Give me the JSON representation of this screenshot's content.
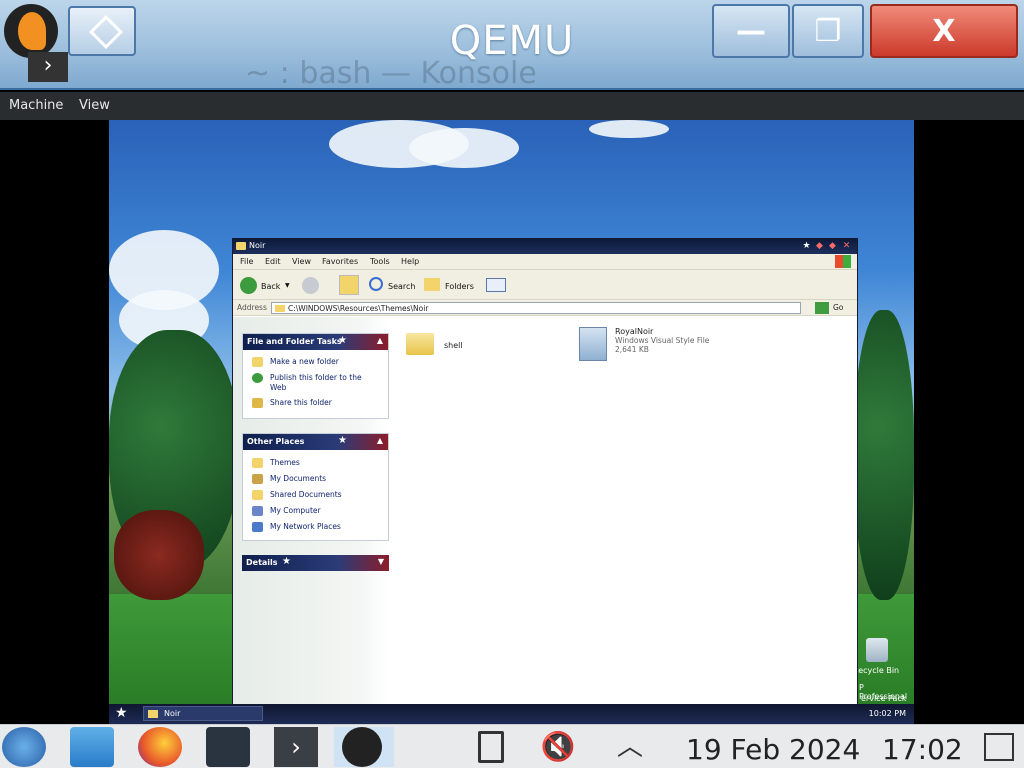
{
  "host": {
    "title": "QEMU",
    "ghost_title": "~ : bash — Konsole",
    "minimize_label": "—",
    "close_label": "X",
    "menu": [
      "Machine",
      "View"
    ]
  },
  "explorer": {
    "title": "Noir",
    "menu": [
      "File",
      "Edit",
      "View",
      "Favorites",
      "Tools",
      "Help"
    ],
    "toolbar": {
      "back": "Back",
      "search": "Search",
      "folders": "Folders"
    },
    "address_label": "Address",
    "address_value": "C:\\WINDOWS\\Resources\\Themes\\Noir",
    "go_label": "Go",
    "panels": {
      "tasks": {
        "title": "File and Folder Tasks",
        "items": [
          "Make a new folder",
          "Publish this folder to the Web",
          "Share this folder"
        ]
      },
      "places": {
        "title": "Other Places",
        "items": [
          "Themes",
          "My Documents",
          "Shared Documents",
          "My Computer",
          "My Network Places"
        ]
      },
      "details": {
        "title": "Details"
      }
    },
    "files": [
      {
        "name": "shell"
      },
      {
        "name": "RoyalNoir",
        "type": "Windows Visual Style File",
        "size": "2,641 KB"
      }
    ]
  },
  "guest": {
    "desktop_labels": [
      "Recycle Bin",
      "P Professional",
      "ervice Pack 3)"
    ],
    "taskbar_item": "Noir",
    "clock": "10:02 PM"
  },
  "taskbar": {
    "date": "19 Feb 2024",
    "time": "17:02"
  },
  "colors": {
    "accent": "#1d2e5c",
    "flag_red": "#8c1d2b"
  }
}
